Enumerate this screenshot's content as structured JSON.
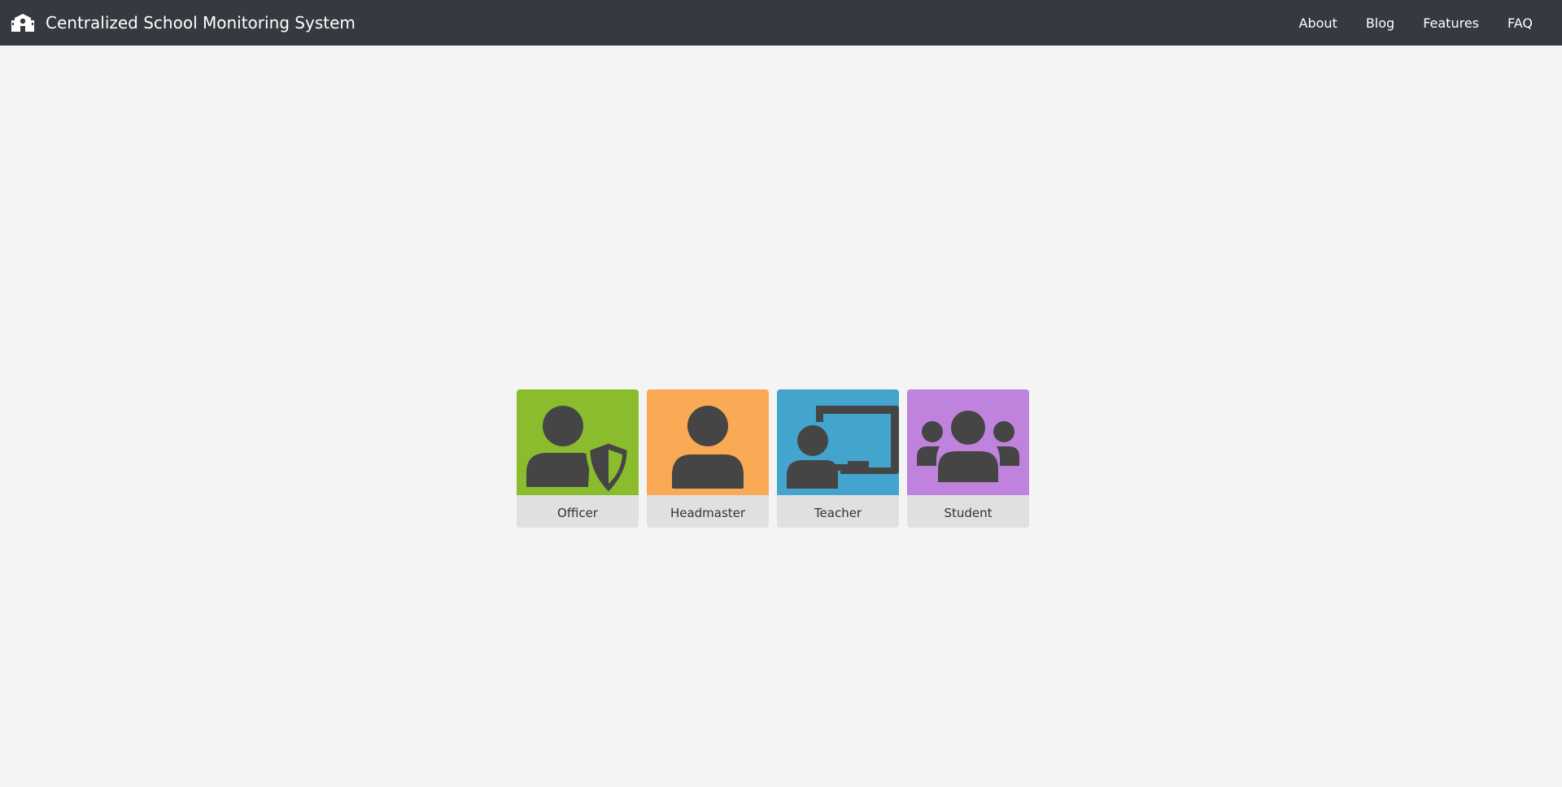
{
  "navbar": {
    "brand_icon": "school-icon",
    "title": "Centralized School Monitoring System",
    "links": [
      {
        "label": "About"
      },
      {
        "label": "Blog"
      },
      {
        "label": "Features"
      },
      {
        "label": "FAQ"
      }
    ],
    "background_color": "#343a40"
  },
  "roles": [
    {
      "label": "Officer",
      "icon": "user-shield-icon",
      "color": "#8bbc2e"
    },
    {
      "label": "Headmaster",
      "icon": "user-icon",
      "color": "#faa955"
    },
    {
      "label": "Teacher",
      "icon": "chalkboard-teacher-icon",
      "color": "#43a5cd"
    },
    {
      "label": "Student",
      "icon": "users-icon",
      "color": "#c083dd"
    }
  ],
  "colors": {
    "icon": "#454545",
    "label_background": "#e0e0e0",
    "page_background": "#f4f4f4"
  }
}
